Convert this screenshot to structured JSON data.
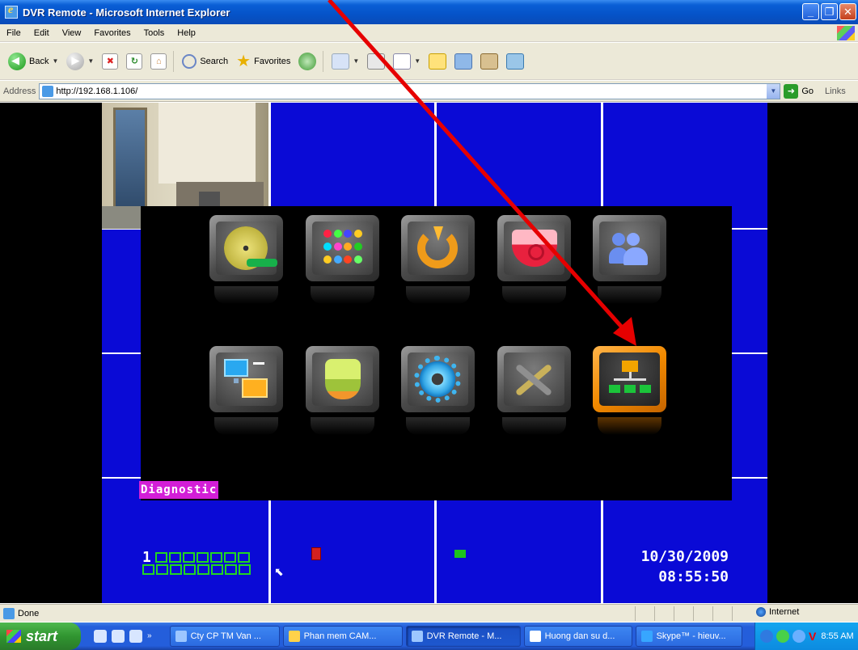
{
  "window": {
    "title": "DVR Remote - Microsoft Internet Explorer"
  },
  "menu": [
    "File",
    "Edit",
    "View",
    "Favorites",
    "Tools",
    "Help"
  ],
  "toolbar": {
    "back": "Back",
    "search": "Search",
    "favorites": "Favorites"
  },
  "address": {
    "label": "Address",
    "url": "http://192.168.1.106/",
    "go": "Go",
    "links": "Links"
  },
  "dvr": {
    "selected_label": "Diagnostic",
    "channel_number": "1",
    "date": "10/30/2009",
    "time": "08:55:50",
    "menu_icons": [
      "film-reel-icon",
      "color-dots-icon",
      "rotate-arrow-icon",
      "dome-camera-icon",
      "users-icon",
      "monitors-icon",
      "ptz-camera-icon",
      "gear-icon",
      "tools-icon",
      "network-icon"
    ]
  },
  "status": {
    "text": "Done",
    "zone": "Internet"
  },
  "taskbar": {
    "start": "start",
    "tasks": [
      "Cty CP TM Van ...",
      "Phan mem CAM...",
      "DVR Remote - M...",
      "Huong dan su d...",
      "Skype™ - hieuv..."
    ],
    "clock": "8:55 AM"
  },
  "colors": {
    "dvr_blue": "#0a0ad6",
    "selected_orange": "#f28a00",
    "diag_magenta": "#d31ed7",
    "annotation_red": "#e60000"
  }
}
